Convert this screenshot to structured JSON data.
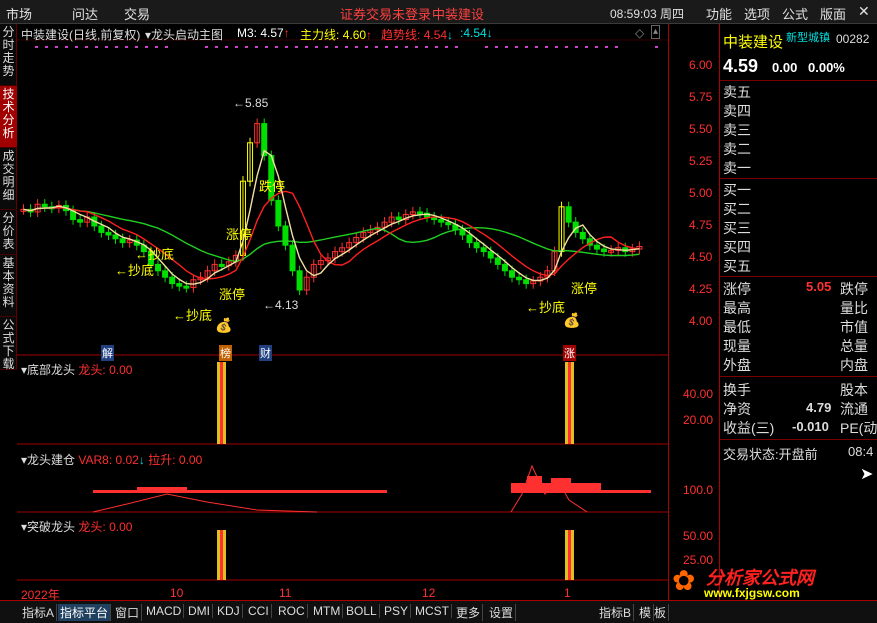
{
  "menu": {
    "market": "市场",
    "wenda": "问达",
    "trade": "交易",
    "login_notice": "证券交易未登录",
    "stock_name": "中装建设",
    "clock": "08:59:03 周四",
    "func": "功能",
    "options": "选项",
    "formula": "公式",
    "layout": "版面"
  },
  "side_tabs": [
    "分时走势",
    "技术分析",
    "成交明细",
    "分价表",
    "基本资料",
    "公式下载"
  ],
  "main_chart": {
    "title": "中装建设(日线,前复权)",
    "indicator": "龙头启动主图",
    "m3_label": "M3:",
    "m3_value": "4.57",
    "main_line_label": "主力线:",
    "main_line_value": "4.60",
    "trend_label": "趋势线:",
    "trend_value": "4.54",
    "extra_label": ":",
    "extra_value": "4.54",
    "y_ticks": [
      "6.00",
      "5.75",
      "5.50",
      "5.25",
      "5.00",
      "4.75",
      "4.50",
      "4.25",
      "4.00"
    ],
    "high_label": "5.85",
    "low_label": "4.13",
    "annotations": [
      "跌停",
      "涨停",
      "涨停",
      "涨停",
      "←抄底",
      "←抄底",
      "←抄底",
      "←抄底"
    ],
    "event_tags": [
      "解",
      "榜",
      "财",
      "涨"
    ]
  },
  "panel1": {
    "title": "底部龙头",
    "var_label": "龙头:",
    "var_value": "0.00",
    "y_ticks": [
      "40.00",
      "20.00"
    ]
  },
  "panel2": {
    "title": "龙头建仓",
    "var8_label": "VAR8:",
    "var8_value": "0.02",
    "lift_label": "拉升:",
    "lift_value": "0.00",
    "y_ticks": [
      "100.0"
    ]
  },
  "panel3": {
    "title": "突破龙头",
    "var_label": "龙头:",
    "var_value": "0.00",
    "y_ticks": [
      "50.00",
      "25.00"
    ]
  },
  "x_axis": [
    "2022年",
    "10",
    "11",
    "12",
    "1"
  ],
  "right_panel": {
    "name": "中装建设",
    "sector": "新型城镇",
    "code": "00282",
    "price": "4.59",
    "change": "0.00",
    "pct": "0.00%",
    "sell": [
      "卖五",
      "卖四",
      "卖三",
      "卖二",
      "卖一"
    ],
    "buy": [
      "买一",
      "买二",
      "买三",
      "买四",
      "买五"
    ],
    "limit_up_label": "涨停",
    "limit_up_value": "5.05",
    "limit_down_label": "跌停",
    "high_label": "最高",
    "vol_ratio_label": "量比",
    "low_label": "最低",
    "mkt_val_label": "市值",
    "now_vol_label": "现量",
    "total_vol_label": "总量",
    "outer_label": "外盘",
    "inner_label": "内盘",
    "turnover_label": "换手",
    "equity_label": "股本",
    "nav_label": "净资",
    "nav_value": "4.79",
    "float_label": "流通",
    "eps_label": "收益(三)",
    "eps_value": "-0.010",
    "pe_label": "PE(动",
    "status_label": "交易状态:",
    "status_value": "开盘前",
    "status_time": "08:4"
  },
  "bottom_tabs": [
    "指标A",
    "指标平台",
    "窗口",
    "MACD",
    "DMI",
    "KDJ",
    "CCI",
    "ROC",
    "MTM",
    "BOLL",
    "PSY",
    "MCST",
    "更多",
    "设置",
    "指标B",
    "模",
    "板"
  ],
  "watermark": {
    "brand": "分析家公式网",
    "url": "www.fxjgsw.com"
  },
  "colors": {
    "up": "#ff3030",
    "down": "#00e000",
    "yellow": "#ffff00",
    "cyan": "#00e0e0",
    "bg": "#000000",
    "border": "#a00000"
  }
}
